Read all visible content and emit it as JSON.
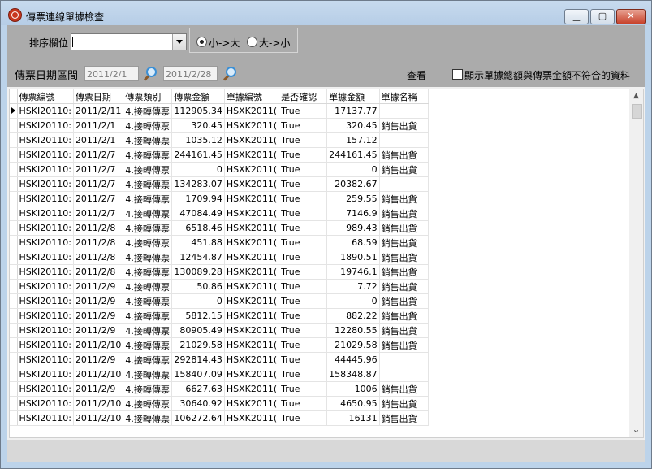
{
  "window": {
    "title": "傳票連線單據檢查",
    "min_glyph": "▁",
    "max_glyph": "▢",
    "close_glyph": "✕"
  },
  "toolbar": {
    "sort_label": "排序欄位",
    "sort_value": "",
    "radio_asc_label": "小->大",
    "radio_desc_label": "大->小",
    "radio_selected": "asc",
    "date_label": "傳票日期區間",
    "date_from": "2011/2/1",
    "date_to": "2011/2/28",
    "query_label": "查看",
    "mismatch_checkbox_label": "顯示單據總額與傳票金額不符合的資料",
    "mismatch_checked": false
  },
  "grid": {
    "columns": [
      "傳票編號",
      "傳票日期",
      "傳票類別",
      "傳票金額",
      "單據編號",
      "是否確認",
      "單據金額",
      "單據名稱"
    ],
    "current_row": 0,
    "rows": [
      [
        "HSKI20110:",
        "2011/2/11",
        "4.接轉傳票",
        "112905.34",
        "HSXK2011(",
        "True",
        "17137.77",
        ""
      ],
      [
        "HSKI20110:",
        "2011/2/1",
        "4.接轉傳票",
        "320.45",
        "HSXK2011(",
        "True",
        "320.45",
        "銷售出貨"
      ],
      [
        "HSKI20110:",
        "2011/2/1",
        "4.接轉傳票",
        "1035.12",
        "HSXK2011(",
        "True",
        "157.12",
        ""
      ],
      [
        "HSKI20110:",
        "2011/2/7",
        "4.接轉傳票",
        "244161.45",
        "HSXK2011(",
        "True",
        "244161.45",
        "銷售出貨"
      ],
      [
        "HSKI20110:",
        "2011/2/7",
        "4.接轉傳票",
        "0",
        "HSXK2011(",
        "True",
        "0",
        "銷售出貨"
      ],
      [
        "HSKI20110:",
        "2011/2/7",
        "4.接轉傳票",
        "134283.07",
        "HSXK2011(",
        "True",
        "20382.67",
        ""
      ],
      [
        "HSKI20110:",
        "2011/2/7",
        "4.接轉傳票",
        "1709.94",
        "HSXK2011(",
        "True",
        "259.55",
        "銷售出貨"
      ],
      [
        "HSKI20110:",
        "2011/2/7",
        "4.接轉傳票",
        "47084.49",
        "HSXK2011(",
        "True",
        "7146.9",
        "銷售出貨"
      ],
      [
        "HSKI20110:",
        "2011/2/8",
        "4.接轉傳票",
        "6518.46",
        "HSXK2011(",
        "True",
        "989.43",
        "銷售出貨"
      ],
      [
        "HSKI20110:",
        "2011/2/8",
        "4.接轉傳票",
        "451.88",
        "HSXK2011(",
        "True",
        "68.59",
        "銷售出貨"
      ],
      [
        "HSKI20110:",
        "2011/2/8",
        "4.接轉傳票",
        "12454.87",
        "HSXK2011(",
        "True",
        "1890.51",
        "銷售出貨"
      ],
      [
        "HSKI20110:",
        "2011/2/8",
        "4.接轉傳票",
        "130089.28",
        "HSXK2011(",
        "True",
        "19746.1",
        "銷售出貨"
      ],
      [
        "HSKI20110:",
        "2011/2/9",
        "4.接轉傳票",
        "50.86",
        "HSXK2011(",
        "True",
        "7.72",
        "銷售出貨"
      ],
      [
        "HSKI20110:",
        "2011/2/9",
        "4.接轉傳票",
        "0",
        "HSXK2011(",
        "True",
        "0",
        "銷售出貨"
      ],
      [
        "HSKI20110:",
        "2011/2/9",
        "4.接轉傳票",
        "5812.15",
        "HSXK2011(",
        "True",
        "882.22",
        "銷售出貨"
      ],
      [
        "HSKI20110:",
        "2011/2/9",
        "4.接轉傳票",
        "80905.49",
        "HSXK2011(",
        "True",
        "12280.55",
        "銷售出貨"
      ],
      [
        "HSKI20110:",
        "2011/2/10",
        "4.接轉傳票",
        "21029.58",
        "HSXK2011(",
        "True",
        "21029.58",
        "銷售出貨"
      ],
      [
        "HSKI20110:",
        "2011/2/9",
        "4.接轉傳票",
        "292814.43",
        "HSXK2011(",
        "True",
        "44445.96",
        ""
      ],
      [
        "HSKI20110:",
        "2011/2/10",
        "4.接轉傳票",
        "158407.09",
        "HSXK2011(",
        "True",
        "158348.87",
        ""
      ],
      [
        "HSKI20110:",
        "2011/2/9",
        "4.接轉傳票",
        "6627.63",
        "HSXK2011(",
        "True",
        "1006",
        "銷售出貨"
      ],
      [
        "HSKI20110:",
        "2011/2/10",
        "4.接轉傳票",
        "30640.92",
        "HSXK2011(",
        "True",
        "4650.95",
        "銷售出貨"
      ],
      [
        "HSKI20110:",
        "2011/2/10",
        "4.接轉傳票",
        "106272.64",
        "HSXK2011(",
        "True",
        "16131",
        "銷售出貨"
      ]
    ]
  },
  "scrollbar": {
    "up_glyph": "▲",
    "down_glyph": "⌄"
  }
}
